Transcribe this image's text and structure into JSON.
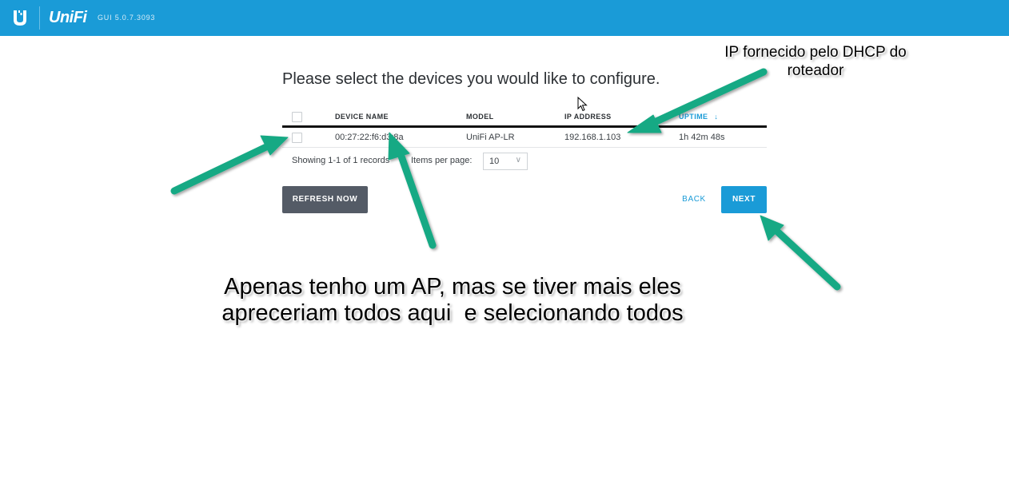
{
  "header": {
    "gui_version": "GUI 5.0.7.3093",
    "brand": "UniFi",
    "color": "#1a9bd7"
  },
  "main": {
    "heading": "Please select the devices you would like to configure.",
    "table": {
      "columns": [
        "DEVICE NAME",
        "MODEL",
        "IP ADDRESS",
        "UPTIME"
      ],
      "sorted_column": "UPTIME",
      "sort_indicator": "↓",
      "rows": [
        {
          "device_name": "00:27:22:f6:d3:8a",
          "model": "UniFi AP-LR",
          "ip_address": "192.168.1.103",
          "uptime": "1h 42m 48s",
          "checked": false
        }
      ]
    },
    "pagination": {
      "showing": "Showing 1-1 of 1 records",
      "items_per_page_label": "Items per page:",
      "items_per_page": "10"
    },
    "buttons": {
      "refresh": "REFRESH NOW",
      "back": "BACK",
      "next": "NEXT"
    }
  },
  "annotations": {
    "top_line1": "IP fornecido pelo DHCP do",
    "top_line2": "roteador",
    "bottom_line1": "Apenas tenho um AP, mas se tiver mais eles",
    "bottom_line2": "apreceriam todos aqui  e selecionando todos",
    "arrow_color": "#18a984"
  }
}
